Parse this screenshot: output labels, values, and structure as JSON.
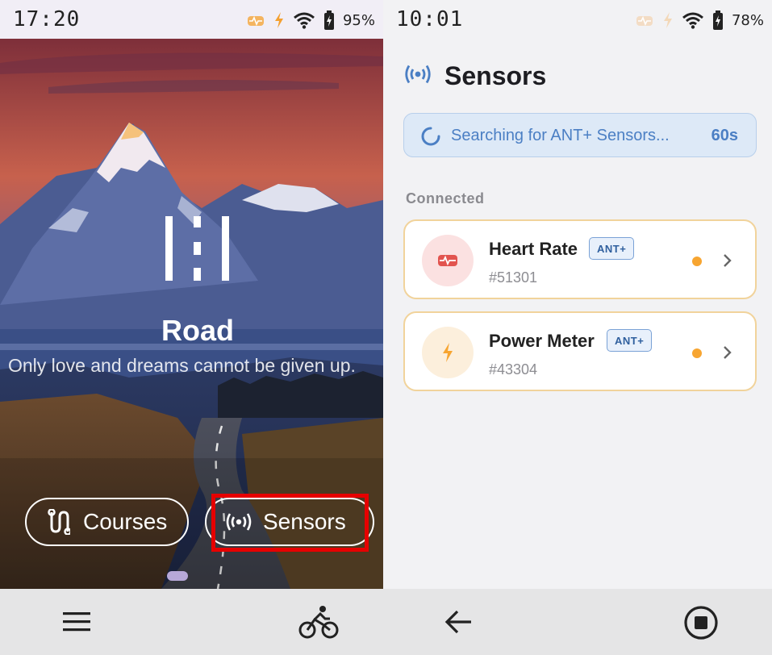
{
  "left_screen": {
    "status_bar": {
      "time": "17:20",
      "battery": "95%"
    },
    "hero": {
      "title": "Road",
      "subtitle": "Only love and dreams cannot be given up."
    },
    "buttons": {
      "courses": "Courses",
      "sensors": "Sensors"
    },
    "bottom_nav": {
      "menu_icon": "hamburger-menu-icon",
      "ride_icon": "bicycle-icon"
    }
  },
  "right_screen": {
    "status_bar": {
      "time": "10:01",
      "battery": "78%"
    },
    "header": {
      "title": "Sensors"
    },
    "search": {
      "text": "Searching for ANT+ Sensors...",
      "countdown": "60s"
    },
    "section_label": "Connected",
    "sensors": [
      {
        "name": "Heart Rate",
        "badge": "ANT+",
        "id": "#51301",
        "icon": "heart-rate-icon"
      },
      {
        "name": "Power Meter",
        "badge": "ANT+",
        "id": "#43304",
        "icon": "lightning-icon"
      }
    ],
    "bottom_nav": {
      "back_icon": "back-arrow-icon",
      "stop_icon": "stop-icon"
    }
  },
  "colors": {
    "accent_blue": "#4b7fc4",
    "status_orange": "#f7a531",
    "highlight_red": "#e60000"
  }
}
